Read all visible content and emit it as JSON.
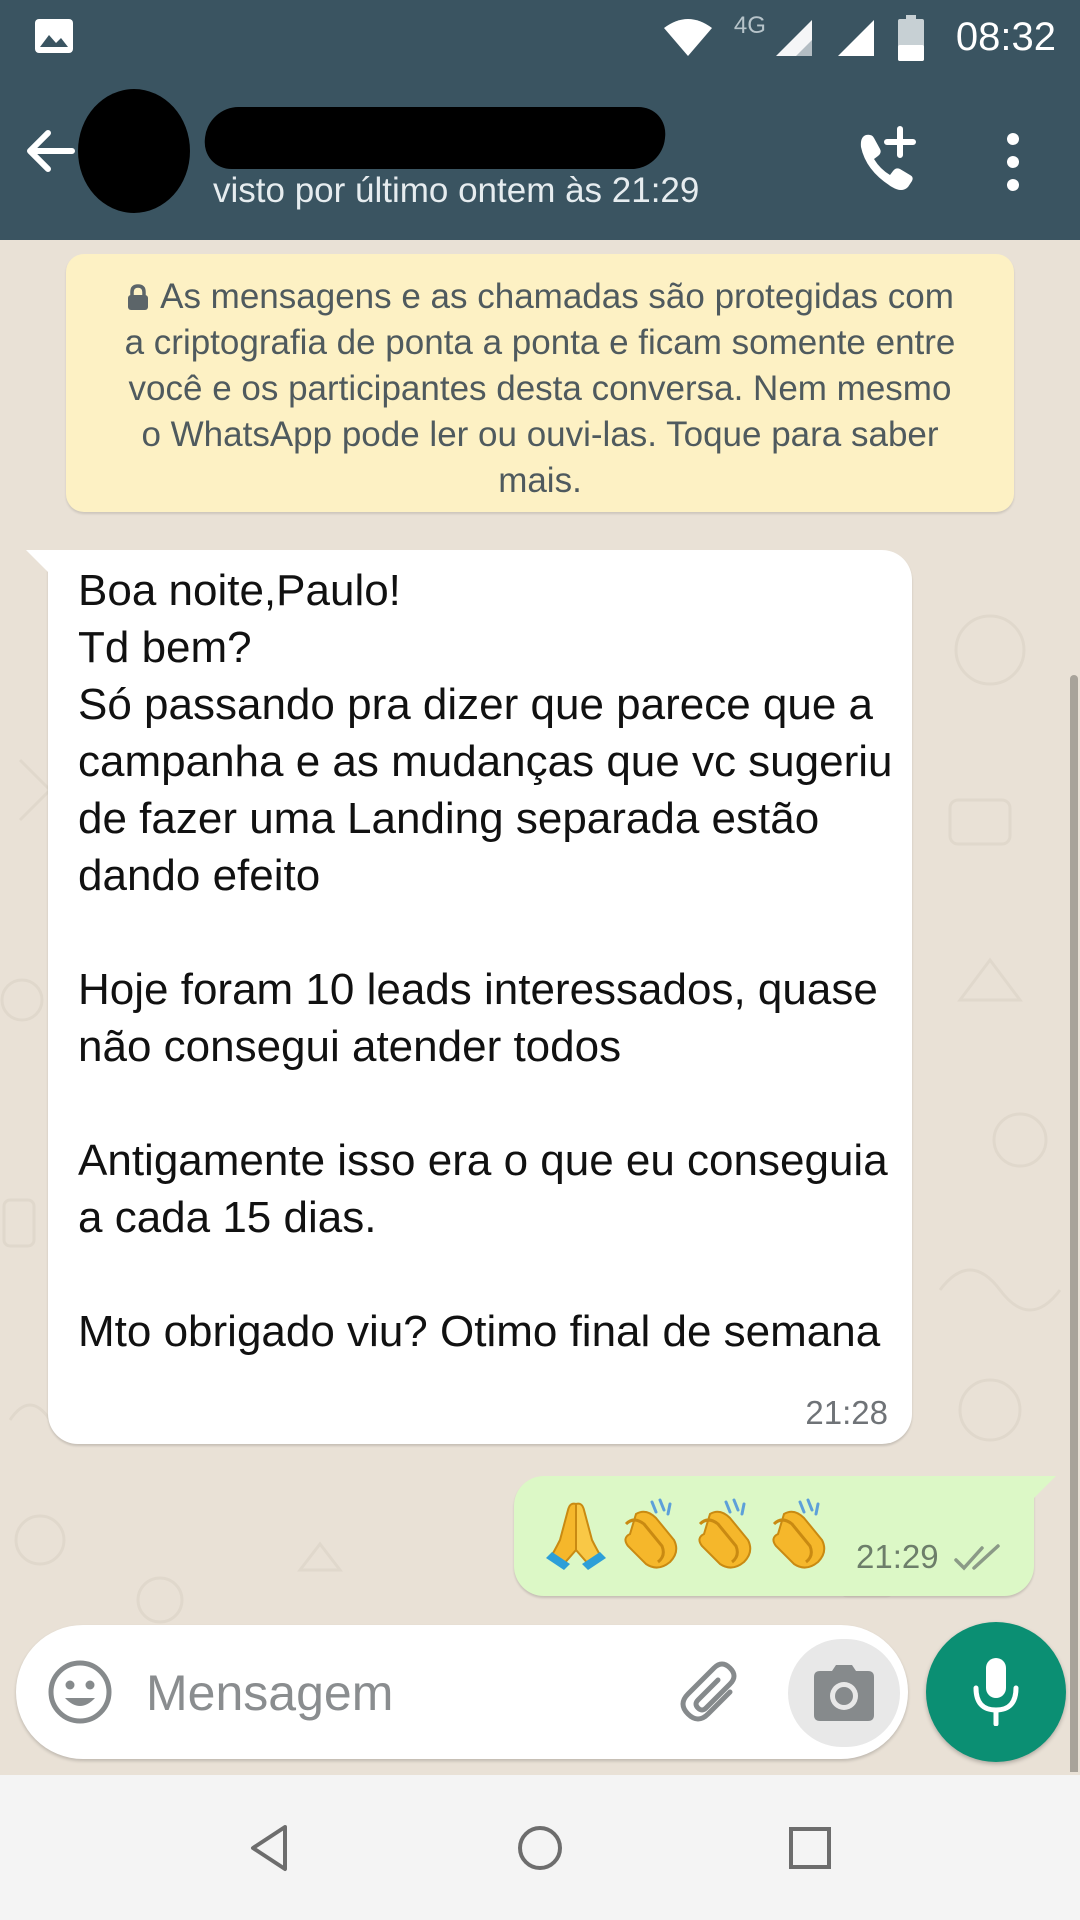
{
  "status_bar": {
    "time": "08:32",
    "network": "4G",
    "icons": [
      "image-icon",
      "wifi-icon",
      "signal-icon",
      "signal-icon",
      "battery-icon"
    ]
  },
  "header": {
    "last_seen": "visto por último ontem às 21:29",
    "icons": [
      "back-arrow-icon",
      "add-call-icon",
      "more-vert-icon"
    ]
  },
  "encryption_notice": {
    "text": "As mensagens e as chamadas são protegidas com a criptografia de ponta a ponta e ficam somente entre você e os participantes desta conversa. Nem mesmo o WhatsApp pode ler ou ouvi-las. Toque para saber mais."
  },
  "messages": [
    {
      "direction": "incoming",
      "text": "Boa noite,Paulo!\nTd bem?\nSó passando pra dizer que parece que a campanha e as mudanças que vc sugeriu de fazer uma Landing separada estão dando efeito\n\nHoje foram 10 leads interessados, quase não consegui atender todos\n\nAntigamente isso era o que eu conseguia a cada 15 dias.\n\nMto obrigado viu? Otimo final de semana",
      "time": "21:28"
    },
    {
      "direction": "outgoing",
      "emojis": [
        "folded-hands-emoji",
        "clapping-hands-emoji",
        "clapping-hands-emoji",
        "clapping-hands-emoji"
      ],
      "time": "21:29",
      "status": "delivered-double-check"
    }
  ],
  "composer": {
    "placeholder": "Mensagem"
  },
  "colors": {
    "header": "#3a5461",
    "chat_background": "#e9e1d6",
    "incoming_bubble": "#ffffff",
    "outgoing_bubble": "#dcf8c6",
    "notice_background": "#fdf1c4",
    "mic_button": "#0b8f73"
  }
}
